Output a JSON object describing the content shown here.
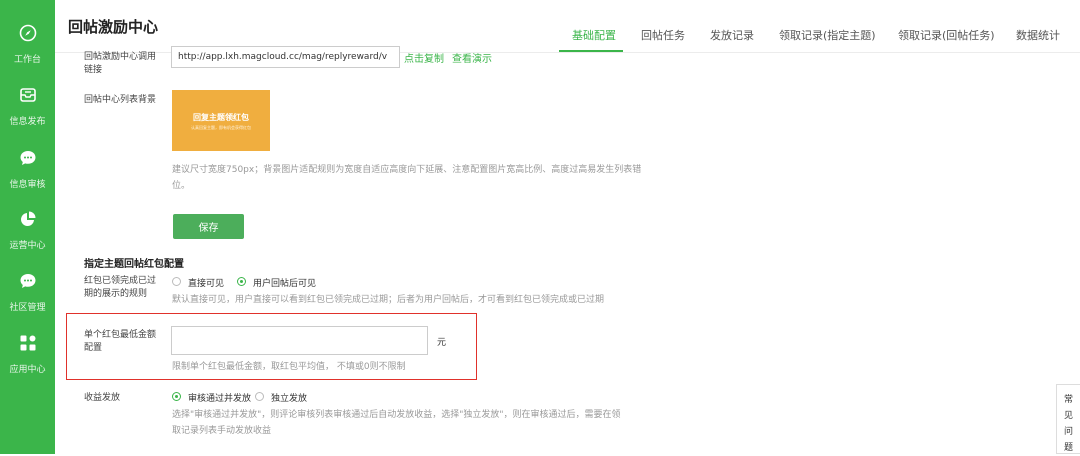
{
  "sidebar": {
    "items": [
      {
        "label": "工作台",
        "icon": "compass-icon"
      },
      {
        "label": "信息发布",
        "icon": "publish-icon"
      },
      {
        "label": "信息审核",
        "icon": "chat-bubble-icon"
      },
      {
        "label": "运营中心",
        "icon": "pie-chart-icon"
      },
      {
        "label": "社区管理",
        "icon": "community-bubble-icon"
      },
      {
        "label": "应用中心",
        "icon": "grid-apps-icon"
      }
    ],
    "bg_color": "#3bb54a"
  },
  "header": {
    "title": "回帖激励中心",
    "tabs": [
      {
        "label": "基础配置",
        "active": true
      },
      {
        "label": "回帖任务",
        "active": false
      },
      {
        "label": "发放记录",
        "active": false
      },
      {
        "label": "领取记录(指定主题)",
        "active": false
      },
      {
        "label": "领取记录(回帖任务)",
        "active": false
      },
      {
        "label": "数据统计",
        "active": false
      }
    ]
  },
  "form": {
    "link_label": "回帖激励中心调用链接",
    "link_value": "http://app.lxh.magcloud.cc/mag/replyreward/v",
    "copy_link": "点击复制",
    "demo_link": "查看演示",
    "bg_label": "回帖中心列表背景",
    "banner_title": "回复主题领红包",
    "banner_sub": "认真回复主题，即有机会获得红包",
    "bg_hint": "建议尺寸宽度750px；背景图片适配规则为宽度自适应高度向下延展、注意配置图片宽高比例、高度过高易发生列表错位。",
    "save_label": "保存"
  },
  "redpacket": {
    "section_title": "指定主题回帖红包配置",
    "rule_label": "红包已领完成已过期的展示的规则",
    "rule_options": [
      {
        "label": "直接可见",
        "checked": false
      },
      {
        "label": "用户回帖后可见",
        "checked": true
      }
    ],
    "rule_hint": "默认直接可见，用户直接可以看到红包已领完成已过期；后者为用户回帖后，才可看到红包已领完成或已过期",
    "min_amount_label": "单个红包最低金额配置",
    "min_amount_value": "",
    "unit": "元",
    "min_amount_hint": "限制单个红包最低金额，取红包平均值， 不填或0则不限制",
    "payout_label": "收益发放",
    "payout_options": [
      {
        "label": "审核通过并发放",
        "checked": true
      },
      {
        "label": "独立发放",
        "checked": false
      }
    ],
    "payout_hint": "选择\"审核通过并发放\"，则评论审核列表审核通过后自动发放收益，选择\"独立发放\"，则在审核通过后，需要在领取记录列表手动发放收益"
  },
  "faq": {
    "label": "常见问题"
  },
  "colors": {
    "accent": "#3bb54a",
    "highlight_border": "#e0312b",
    "banner": "#f0ae3f"
  }
}
